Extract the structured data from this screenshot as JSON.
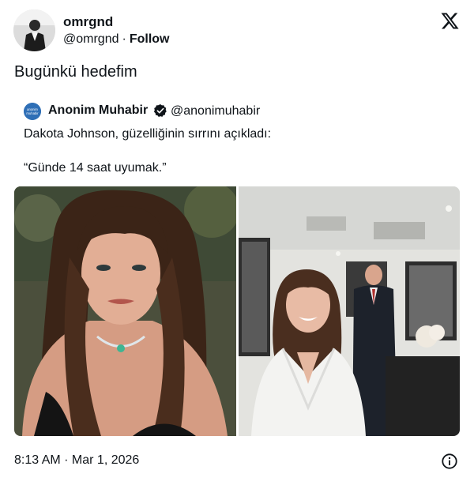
{
  "author": {
    "name": "omrgnd",
    "handle": "@omrgnd",
    "separator": "·",
    "follow_label": "Follow"
  },
  "tweet": {
    "text": "Bugünkü hedefim",
    "timestamp": "8:13 AM · Mar 1, 2026"
  },
  "quote": {
    "name": "Anonim Muhabir",
    "handle": "@anonimuhabir",
    "avatar_text": "anonim muhabir",
    "line1": "Dakota Johnson, güzelliğinin sırrını açıkladı:",
    "line2": "“Günde 14 saat uyumak.”"
  },
  "icons": {
    "brand": "x-logo-icon",
    "verified": "verified-badge-icon",
    "info": "info-icon"
  },
  "colors": {
    "text": "#0f1419",
    "verified_badge": "#0f1419",
    "quote_avatar": "#2f6fb6"
  }
}
